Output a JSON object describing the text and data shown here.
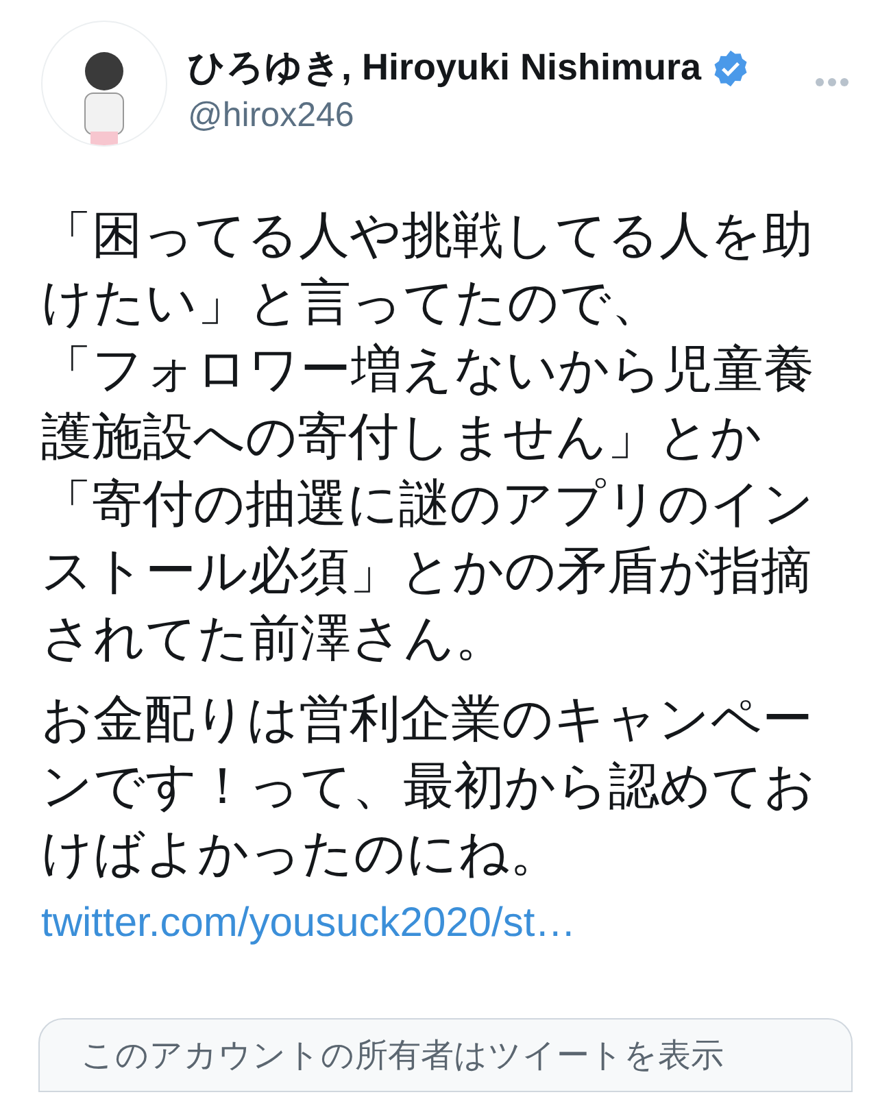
{
  "author": {
    "name": "ひろゆき, Hiroyuki Nishimura",
    "verified": true,
    "handle": "@hirox246"
  },
  "paragraphs": [
    [
      "「困ってる人や挑戦してる人を助けたい」と言ってたので、",
      "「フォロワー増えないから児童養護施設への寄付しません」とか",
      "「寄付の抽選に謎のアプリのインストール必須」とかの矛盾が指摘されてた前澤さん。"
    ],
    [
      "お金配りは営利企業のキャンペーンです！って、最初から認めておけばよかったのにね。"
    ]
  ],
  "link": "twitter.com/yousuck2020/st…",
  "notice": "このアカウントの所有者はツイートを表示"
}
